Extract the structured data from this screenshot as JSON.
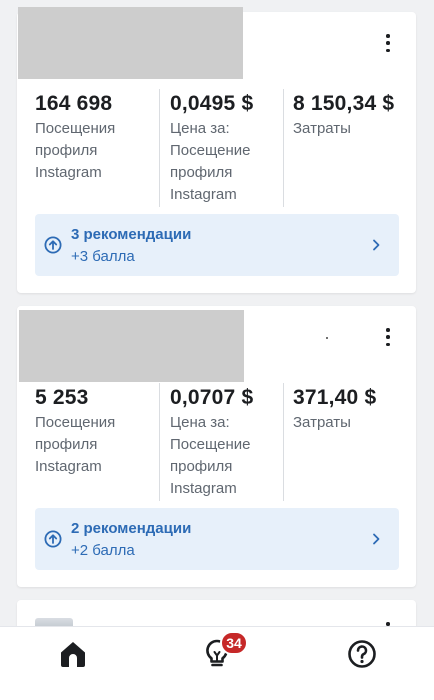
{
  "cards": [
    {
      "stats": [
        {
          "value": "164 698",
          "label_lines": [
            "Посещения",
            "профиля",
            "Instagram"
          ]
        },
        {
          "value": "0,0495 $",
          "label_lines": [
            "Цена за:",
            "Посещение",
            "профиля",
            "Instagram"
          ]
        },
        {
          "value": "8 150,34 $",
          "label_lines": [
            "Затраты"
          ]
        }
      ],
      "recommendation": {
        "title": "3 рекомендации",
        "subtitle": "+3 балла"
      }
    },
    {
      "stats": [
        {
          "value": "5 253",
          "label_lines": [
            "Посещения",
            "профиля",
            "Instagram"
          ]
        },
        {
          "value": "0,0707 $",
          "label_lines": [
            "Цена за:",
            "Посещение",
            "профиля",
            "Instagram"
          ]
        },
        {
          "value": "371,40 $",
          "label_lines": [
            "Затраты"
          ]
        }
      ],
      "recommendation": {
        "title": "2 рекомендации",
        "subtitle": "+2 балла"
      }
    }
  ],
  "bottom_nav": {
    "items": [
      {
        "icon": "home-icon"
      },
      {
        "icon": "lightbulb-icon"
      },
      {
        "icon": "help-icon"
      }
    ],
    "badge": "34"
  },
  "colors": {
    "accent": "#2d6bb5",
    "reco_bg": "#e7f0fa",
    "badge": "#c62828"
  }
}
